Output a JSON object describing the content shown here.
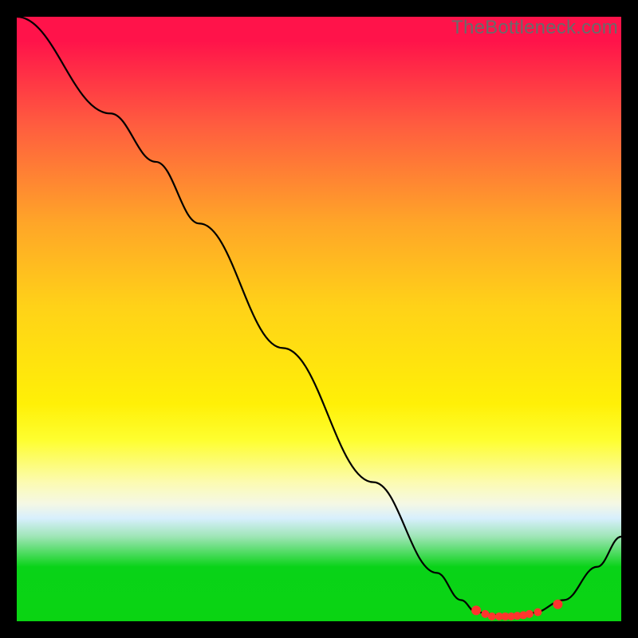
{
  "watermark": "TheBottleneck.com",
  "chart_data": {
    "type": "line",
    "title": "",
    "xlabel": "",
    "ylabel": "",
    "xlim": [
      0,
      1
    ],
    "ylim": [
      0,
      1
    ],
    "series": [
      {
        "name": "curve",
        "points": [
          {
            "x": 0.0,
            "y": 1.0
          },
          {
            "x": 0.155,
            "y": 0.84
          },
          {
            "x": 0.23,
            "y": 0.76
          },
          {
            "x": 0.302,
            "y": 0.658
          },
          {
            "x": 0.44,
            "y": 0.452
          },
          {
            "x": 0.59,
            "y": 0.23
          },
          {
            "x": 0.695,
            "y": 0.08
          },
          {
            "x": 0.735,
            "y": 0.035
          },
          {
            "x": 0.76,
            "y": 0.015
          },
          {
            "x": 0.8,
            "y": 0.01
          },
          {
            "x": 0.855,
            "y": 0.014
          },
          {
            "x": 0.905,
            "y": 0.035
          },
          {
            "x": 0.96,
            "y": 0.09
          },
          {
            "x": 1.0,
            "y": 0.14
          }
        ]
      },
      {
        "name": "markers",
        "points": [
          {
            "x": 0.76,
            "y": 0.018
          },
          {
            "x": 0.775,
            "y": 0.012
          },
          {
            "x": 0.786,
            "y": 0.008
          },
          {
            "x": 0.798,
            "y": 0.008
          },
          {
            "x": 0.808,
            "y": 0.008
          },
          {
            "x": 0.818,
            "y": 0.008
          },
          {
            "x": 0.828,
            "y": 0.009
          },
          {
            "x": 0.838,
            "y": 0.01
          },
          {
            "x": 0.848,
            "y": 0.012
          },
          {
            "x": 0.862,
            "y": 0.015
          },
          {
            "x": 0.895,
            "y": 0.028
          }
        ]
      }
    ],
    "notes": "Axes have no visible tick labels; x/y normalized 0..1. Background is a vertical spectral gradient; curve descends from top-left to a minimum near x≈0.8 then rises; red markers cluster at the trough."
  }
}
